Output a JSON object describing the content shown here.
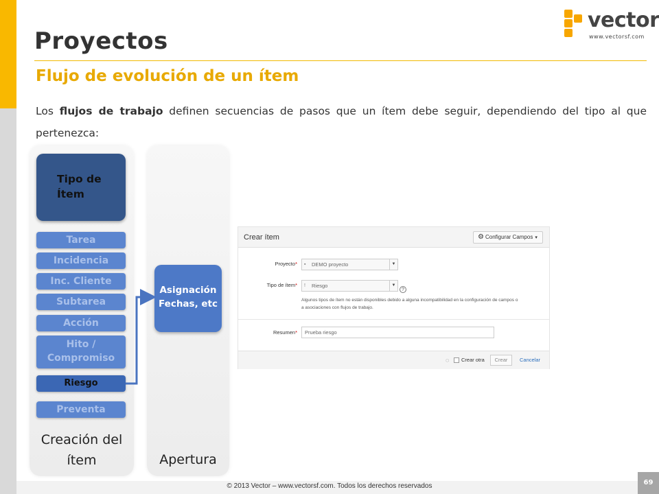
{
  "slide": {
    "title": "Proyectos",
    "subtitle": "Flujo de evolución de un ítem",
    "intro_before": "Los ",
    "intro_bold": "flujos de trabajo",
    "intro_after": " definen secuencias de pasos que un ítem debe seguir, dependiendo del tipo al que pertenezca:",
    "accent_color": "#f9b800"
  },
  "logo": {
    "word": "vector",
    "url": "www.vectorsf.com"
  },
  "flow": {
    "type_box": "Tipo de Ítem",
    "items": [
      {
        "label": "Tarea"
      },
      {
        "label": "Incidencia"
      },
      {
        "label": "Inc. Cliente"
      },
      {
        "label": "Subtarea"
      },
      {
        "label": "Acción"
      },
      {
        "label": "Hito / Compromiso"
      },
      {
        "label": "Riesgo"
      },
      {
        "label": "Preventa"
      }
    ],
    "active_item": "Riesgo",
    "column1_label": "Creación del ítem",
    "step_box": "Asignación Fechas, etc",
    "column2_label": "Apertura"
  },
  "form": {
    "title": "Crear ítem",
    "configure_button": "Configurar Campos",
    "project_label": "Proyecto",
    "project_value": "DEMO proyecto",
    "type_label": "Tipo de ítem",
    "type_value": "Riesgo",
    "note": "Algunos tipos de ítem no están disponibles debido a alguna incompatibilidad en la configuración de campos o a asociaciones con flujos de trabajo.",
    "summary_label": "Resumen",
    "summary_value": "Prueba riesgo",
    "create_another": "Crear otra",
    "create_button": "Crear",
    "cancel_link": "Cancelar"
  },
  "footer": {
    "copyright": "© 2013 Vector – www.vectorsf.com. Todos los derechos reservados",
    "page_number": "69"
  }
}
